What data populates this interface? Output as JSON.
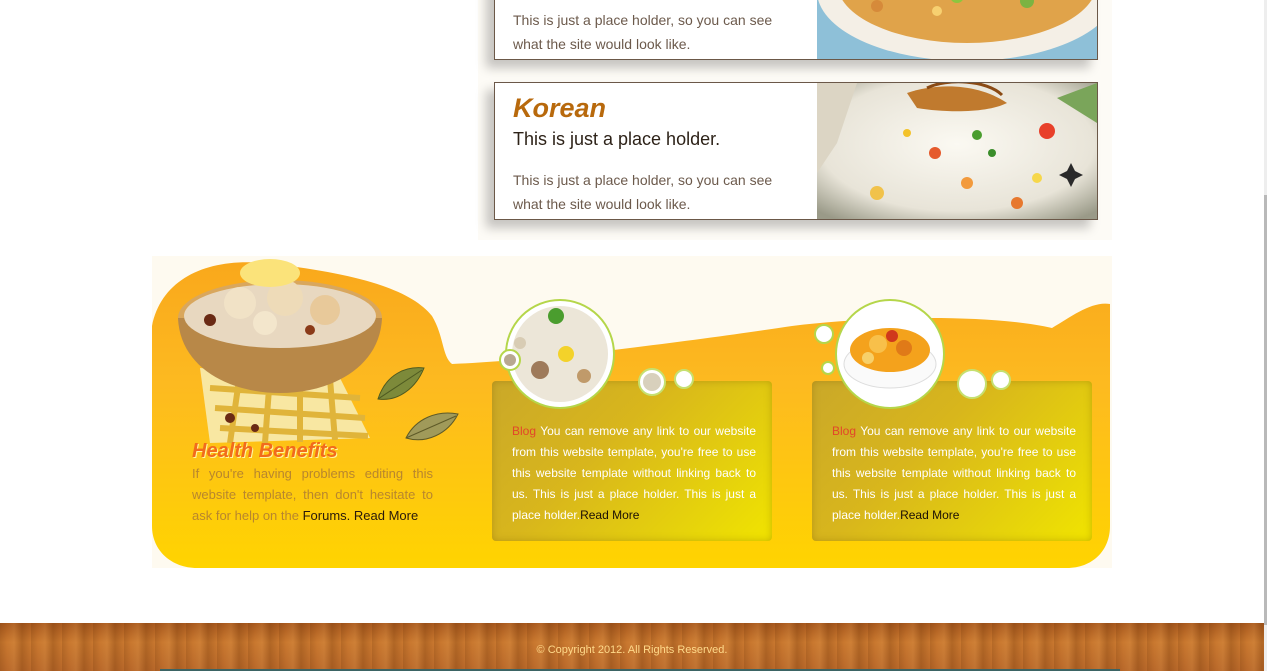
{
  "cards": [
    {
      "title": "",
      "subtitle": "",
      "description": "This is just a place holder, so you can see what the site would look like.",
      "image": "rice-dish-photo"
    },
    {
      "title": "Korean",
      "subtitle": "This is just a place holder.",
      "description": "This is just a place holder, so you can see what the site would look like.",
      "image": "fried-rice-photo"
    }
  ],
  "health": {
    "title": "Health Benefits",
    "text": "If you're having problems editing this website template, then don't hesitate to ask for help on the",
    "link": "Forums",
    "period": ".",
    "read_more": "Read More"
  },
  "blogs": [
    {
      "tag": "Blog",
      "text": "You can remove any link to our website from this website template, you're free to use this website template without linking back to us. This is just a place holder. This is just a place holder.",
      "read_more": "Read More",
      "image": "rice-bubble-photo"
    },
    {
      "tag": "Blog",
      "text": "You can remove any link to our website from this website template, you're free to use this website template without linking back to us. This is just a place holder. This is just a place holder.",
      "read_more": "Read More",
      "image": "curry-bubble-photo"
    }
  ],
  "footer": {
    "copyright": "© Copyright 2012. All Rights Reserved."
  },
  "colors": {
    "title_orange": "#b8690c",
    "band_yellow": "#fcc520",
    "health_title": "#f26a1c",
    "blog_tag": "#e2462a",
    "footer_wood": "#b8682a"
  }
}
